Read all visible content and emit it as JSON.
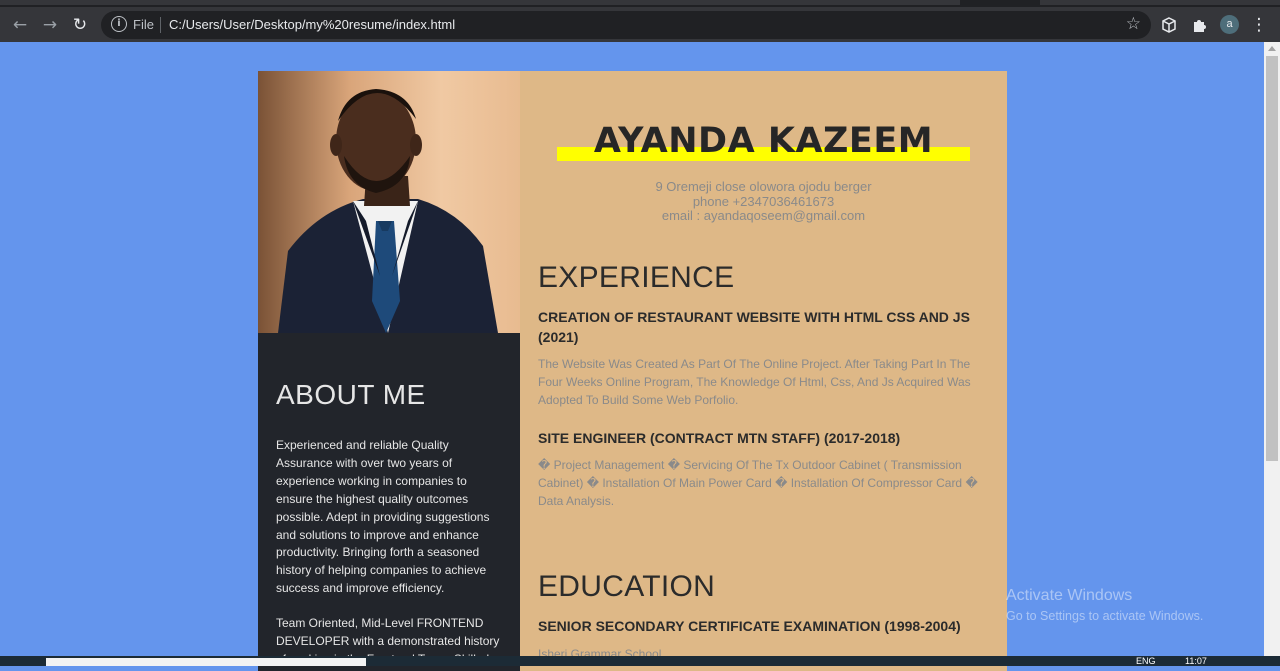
{
  "browser": {
    "url_scheme_label": "File",
    "url": "C:/Users/User/Desktop/my%20resume/index.html",
    "profile_initial": "a"
  },
  "resume": {
    "name": "AYANDA KAZEEM",
    "contact": {
      "address": "9 Oremeji close olowora ojodu berger",
      "phone": "phone +2347036461673",
      "email": "email : ayandaqoseem@gmail.com"
    },
    "about": {
      "title": "ABOUT ME",
      "paragraph1": "Experienced and reliable Quality Assurance with over two years of experience working in companies to ensure the highest quality outcomes possible. Adept in providing suggestions and solutions to improve and enhance productivity. Bringing forth a seasoned history of helping companies to achieve success and improve efficiency.",
      "paragraph2": "Team Oriented, Mid-Level FRONTEND DEVELOPER with a demonstrated history of working in the Frontend Team. Skilled"
    },
    "experience": {
      "title": "EXPERIENCE",
      "items": [
        {
          "title": "CREATION OF RESTAURANT WEBSITE WITH HTML CSS AND JS (2021)",
          "description": "The Website Was Created As Part Of The Online Project. After Taking Part In The Four Weeks Online Program, The Knowledge Of Html, Css, And Js Acquired Was Adopted To Build Some Web Porfolio."
        },
        {
          "title": "SITE ENGINEER (CONTRACT MTN STAFF) (2017-2018)",
          "description": "� Project Management � Servicing Of The Tx Outdoor Cabinet ( Transmission Cabinet) � Installation Of Main Power Card � Installation Of Compressor Card � Data Analysis."
        }
      ]
    },
    "education": {
      "title": "EDUCATION",
      "items": [
        {
          "title": "SENIOR SECONDARY CERTIFICATE EXAMINATION (1998-2004)",
          "description": "Isheri Grammar School."
        }
      ]
    }
  },
  "os": {
    "watermark_line1": "Activate Windows",
    "watermark_line2": "Go to Settings to activate Windows.",
    "tray_lang": "ENG",
    "tray_time": "11:07"
  },
  "colors": {
    "page_bg": "#6495ed",
    "sidebar_bg": "#22252b",
    "content_bg": "#deb887",
    "name_highlight": "#ffff00"
  }
}
